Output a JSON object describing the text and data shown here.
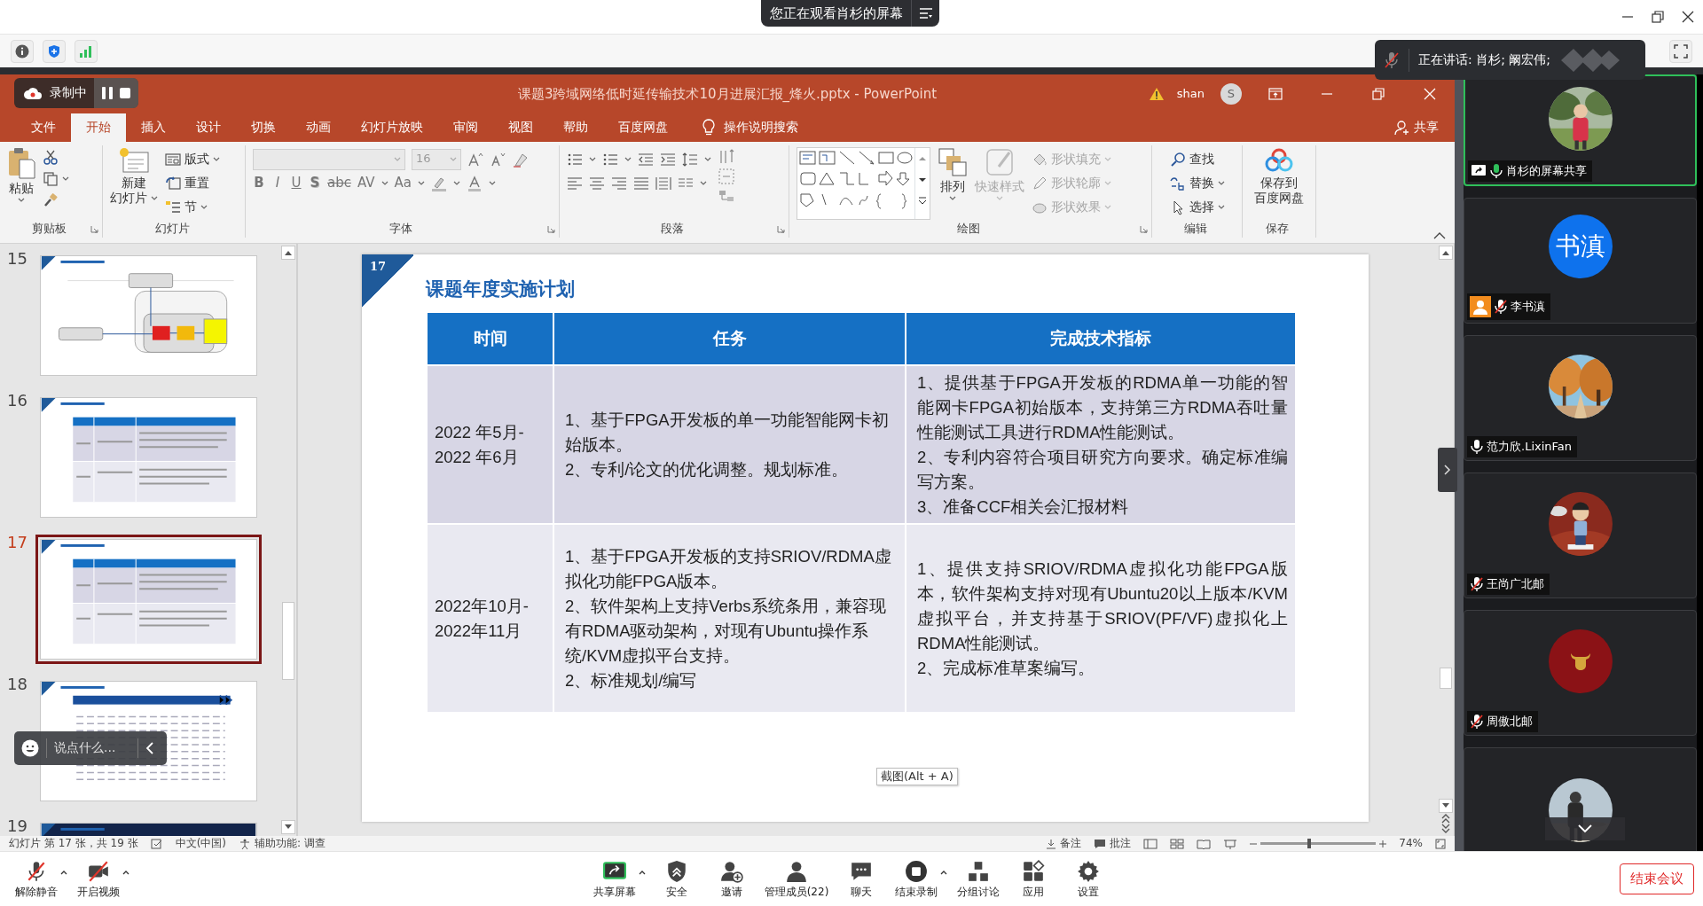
{
  "viewer_banner": {
    "text": "您正在观看肖杉的屏幕"
  },
  "recording": {
    "label": "录制中"
  },
  "speaking_banner": {
    "text": "正在讲话: 肖杉; 阚宏伟;"
  },
  "powerpoint": {
    "title": "课题3跨域网络低时延传输技术10月进展汇报_烽火.pptx  -  PowerPoint",
    "user": "shan",
    "user_initial": "S",
    "tabs": [
      {
        "label": "文件",
        "selected": false
      },
      {
        "label": "开始",
        "selected": true
      },
      {
        "label": "插入",
        "selected": false
      },
      {
        "label": "设计",
        "selected": false
      },
      {
        "label": "切换",
        "selected": false
      },
      {
        "label": "动画",
        "selected": false
      },
      {
        "label": "幻灯片放映",
        "selected": false
      },
      {
        "label": "审阅",
        "selected": false
      },
      {
        "label": "视图",
        "selected": false
      },
      {
        "label": "帮助",
        "selected": false
      },
      {
        "label": "百度网盘",
        "selected": false
      }
    ],
    "tell_me": "操作说明搜索",
    "share": "共享",
    "ribbon": [
      {
        "kind": "clipboard",
        "label": "剪贴板",
        "paste": "粘贴"
      },
      {
        "kind": "slides",
        "label": "幻灯片",
        "new_slide": [
          "新建",
          "幻灯片"
        ],
        "layout": "版式",
        "reset": "重置",
        "section": "节"
      },
      {
        "kind": "font",
        "label": "字体",
        "size": "16",
        "styles": [
          "B",
          "I",
          "U",
          "S",
          "abc",
          "AV",
          "Aa"
        ]
      },
      {
        "kind": "paragraph",
        "label": "段落"
      },
      {
        "kind": "drawing",
        "label": "绘图",
        "arrange": "排列",
        "quick_styles": {
          "label": "快速样式",
          "disabled": true
        },
        "shape_options": [
          {
            "label": "形状填充",
            "disabled": true
          },
          {
            "label": "形状轮廓",
            "disabled": true
          },
          {
            "label": "形状效果",
            "disabled": true
          }
        ]
      },
      {
        "kind": "editing",
        "label": "编辑",
        "find": "查找",
        "replace": "替换",
        "select": "选择"
      },
      {
        "kind": "save",
        "label": "保存",
        "button": [
          "保存到",
          "百度网盘"
        ]
      }
    ],
    "thumbnails": [
      {
        "number": "15",
        "kind": "diagram",
        "selected": false
      },
      {
        "number": "16",
        "kind": "table",
        "selected": false
      },
      {
        "number": "17",
        "kind": "table",
        "selected": true
      },
      {
        "number": "18",
        "kind": "sheet",
        "selected": false
      },
      {
        "number": "19",
        "kind": "cover",
        "selected": false
      }
    ],
    "slide": {
      "number": "17",
      "title": "课题年度实施计划",
      "columns": [
        "时间",
        "任务",
        "完成技术指标"
      ],
      "rows": [
        [
          [
            "2022 年5月-",
            "2022 年6月"
          ],
          [
            "1、基于FPGA开发板的单一功能智能网卡初始版本。",
            "2、专利/论文的优化调整。规划标准。"
          ],
          [
            "1、提供基于FPGA开发板的RDMA单一功能的智能网卡FPGA初始版本，支持第三方RDMA吞吐量性能测试工具进行RDMA性能测试。",
            "2、专利内容符合项目研究方向要求。确定标准编写方案。",
            "3、准备CCF相关会汇报材料"
          ]
        ],
        [
          [
            "2022年10月-",
            "2022年11月"
          ],
          [
            "1、基于FPGA开发板的支持SRIOV/RDMA虚拟化功能FPGA版本。",
            "2、软件架构上支持Verbs系统条用，兼容现有RDMA驱动架构，对现有Ubuntu操作系统/KVM虚拟平台支持。",
            "2、标准规划/编写"
          ],
          [
            "1、提供支持SRIOV/RDMA虚拟化功能FPGA版本，软件架构支持对现有Ubuntu20以上版本/KVM虚拟平台，并支持基于SRIOV(PF/VF)虚拟化上RDMA性能测试。",
            "2、完成标准草案编写。"
          ]
        ]
      ]
    },
    "tooltip": "截图(Alt + A)",
    "status_bar": {
      "slide_info": "幻灯片 第 17 张，共 19 张",
      "language": "中文(中国)",
      "accessibility": "辅助功能: 调查",
      "notes": "备注",
      "comments": "批注",
      "zoom": {
        "level": 0.42,
        "reading": "74%"
      }
    }
  },
  "chat_box": {
    "placeholder": "说点什么..."
  },
  "participants": [
    {
      "avatar": {
        "kind": "picture"
      },
      "name": "肖杉的屏幕共享",
      "sharing": true,
      "host": false,
      "muted": false,
      "speaking": true
    },
    {
      "avatar": {
        "kind": "initials",
        "text": "书滇",
        "color": "#0e72ed"
      },
      "name": "李书滇",
      "sharing": false,
      "host": true,
      "muted": true,
      "speaking": false
    },
    {
      "avatar": {
        "kind": "picture"
      },
      "name": "范力欣.LixinFan",
      "sharing": false,
      "host": false,
      "muted": false,
      "speaking": false
    },
    {
      "avatar": {
        "kind": "picture"
      },
      "name": "王尚广北邮",
      "sharing": false,
      "host": false,
      "muted": true,
      "speaking": false
    },
    {
      "avatar": {
        "kind": "emblem",
        "color": "#8b1216"
      },
      "name": "周傲北邮",
      "sharing": false,
      "host": false,
      "muted": true,
      "speaking": false
    },
    {
      "avatar": {
        "kind": "picture"
      }
    }
  ],
  "toolbar": {
    "items": [
      {
        "kind": "mic-off",
        "label": "解除静音",
        "menu": true
      },
      {
        "kind": "video-off",
        "label": "开启视频",
        "menu": true
      },
      {
        "kind": "share",
        "label": "共享屏幕",
        "menu": true
      },
      {
        "kind": "security",
        "label": "安全",
        "menu": false
      },
      {
        "kind": "invite",
        "label": "邀请",
        "menu": false
      },
      {
        "kind": "participants",
        "label": "管理成员(22)",
        "menu": false
      },
      {
        "kind": "chat",
        "label": "聊天",
        "menu": false
      },
      {
        "kind": "record-stop",
        "label": "结束录制",
        "menu": true
      },
      {
        "kind": "breakout",
        "label": "分组讨论",
        "menu": false
      },
      {
        "kind": "apps",
        "label": "应用",
        "menu": false
      },
      {
        "kind": "settings",
        "label": "设置",
        "menu": false
      }
    ],
    "end_button": "结束会议"
  }
}
